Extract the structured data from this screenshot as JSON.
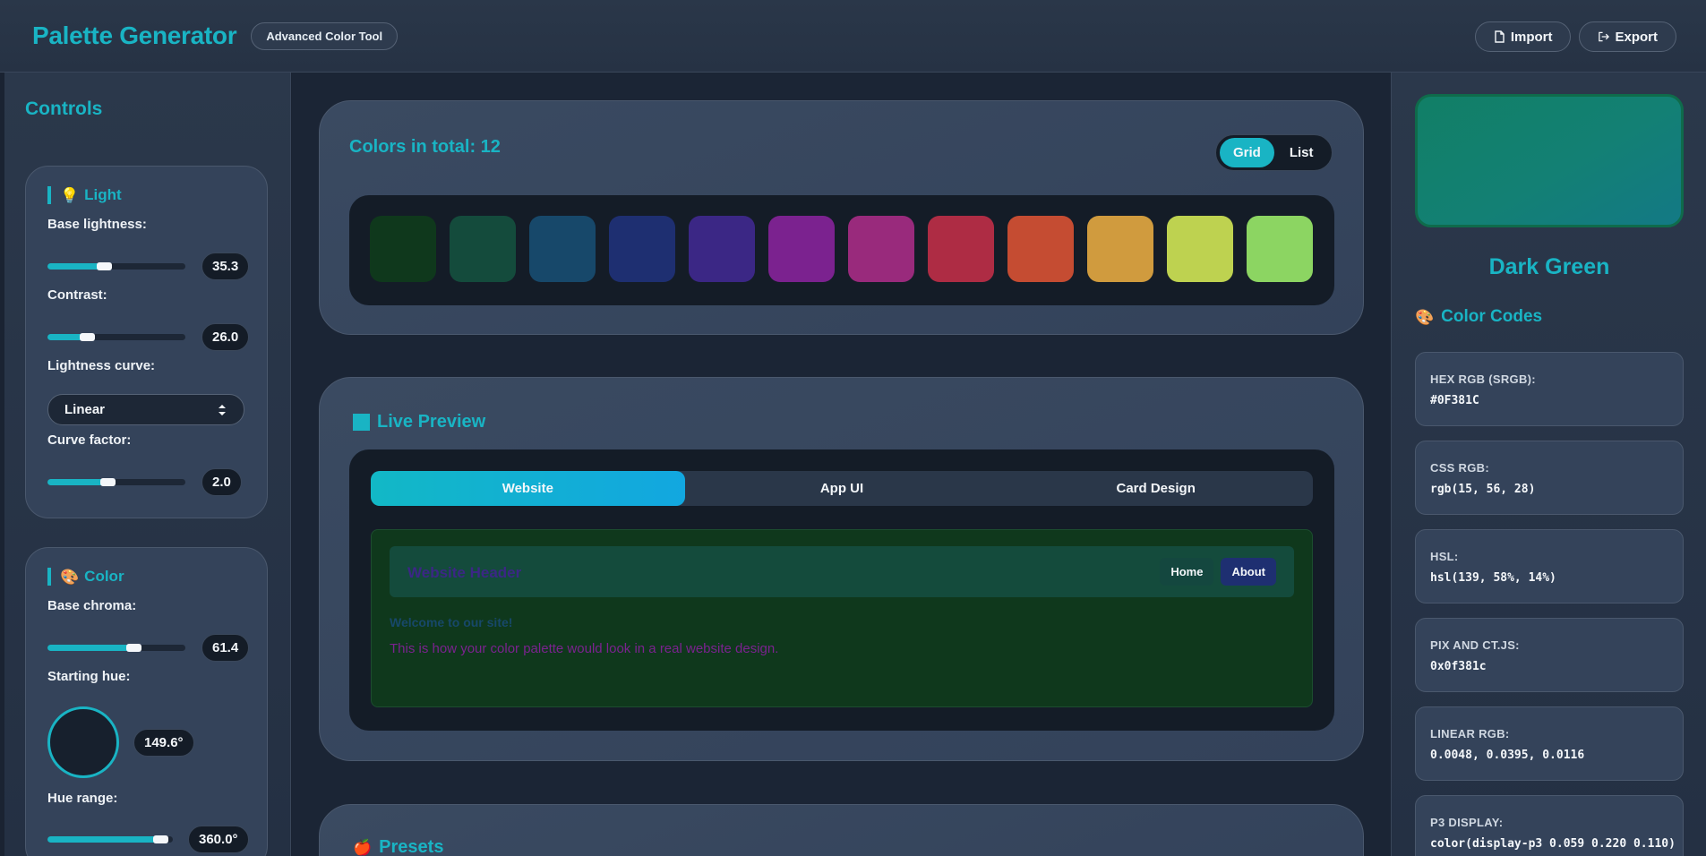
{
  "header": {
    "title": "Palette Generator",
    "badge": "Advanced Color Tool",
    "import_label": "Import",
    "export_label": "Export"
  },
  "controls": {
    "title": "Controls",
    "light": {
      "heading": "Light",
      "icon": "lightbulb-icon",
      "base_lightness_label": "Base lightness:",
      "base_lightness_value": "35.3",
      "base_lightness_fraction": 0.38,
      "contrast_label": "Contrast:",
      "contrast_value": "26.0",
      "contrast_fraction": 0.26,
      "curve_label": "Lightness curve:",
      "curve_value": "Linear",
      "curve_factor_label": "Curve factor:",
      "curve_factor_value": "2.0",
      "curve_factor_fraction": 0.41
    },
    "color": {
      "heading": "Color",
      "icon": "palette-icon",
      "base_chroma_label": "Base chroma:",
      "base_chroma_value": "61.4",
      "base_chroma_fraction": 0.6,
      "starting_hue_label": "Starting hue:",
      "starting_hue_value": "149.6°",
      "hue_range_label": "Hue range:",
      "hue_range_value": "360.0°",
      "hue_range_fraction": 0.87
    }
  },
  "colors": {
    "title": "Colors in total: 12",
    "view_grid": "Grid",
    "view_list": "List",
    "active_view": "Grid",
    "swatches": [
      "#0f381c",
      "#144b3c",
      "#17486a",
      "#1e2f71",
      "#3b2785",
      "#7b228f",
      "#992a7c",
      "#ae2c44",
      "#c54c32",
      "#d09b3e",
      "#bed250",
      "#8cd562"
    ]
  },
  "preview": {
    "title": "Live Preview",
    "tabs": [
      "Website",
      "App UI",
      "Card Design"
    ],
    "active_tab": "Website",
    "site_header_title": "Website Header",
    "nav_home": "Home",
    "nav_about": "About",
    "welcome": "Welcome to our site!",
    "body_text": "This is how your color palette would look in a real website design."
  },
  "presets": {
    "title": "Presets",
    "icon": "apple-icon"
  },
  "selected": {
    "name": "Dark Green",
    "swatch_color": "#0f381c",
    "codes_title": "Color Codes",
    "codes_icon": "palette-icon",
    "codes": [
      {
        "label": "HEX RGB (SRGB):",
        "value": "#0F381C"
      },
      {
        "label": "CSS RGB:",
        "value": "rgb(15, 56, 28)"
      },
      {
        "label": "HSL:",
        "value": "hsl(139, 58%, 14%)"
      },
      {
        "label": "PIX AND CT.JS:",
        "value": "0x0f381c"
      },
      {
        "label": "LINEAR RGB:",
        "value": "0.0048, 0.0395, 0.0116"
      },
      {
        "label": "P3 DISPLAY:",
        "value": "color(display-p3 0.059 0.220 0.110)"
      }
    ]
  },
  "theme": {
    "accent": "#19b4c4",
    "background": "#1a2332",
    "panel": "#34435a"
  }
}
